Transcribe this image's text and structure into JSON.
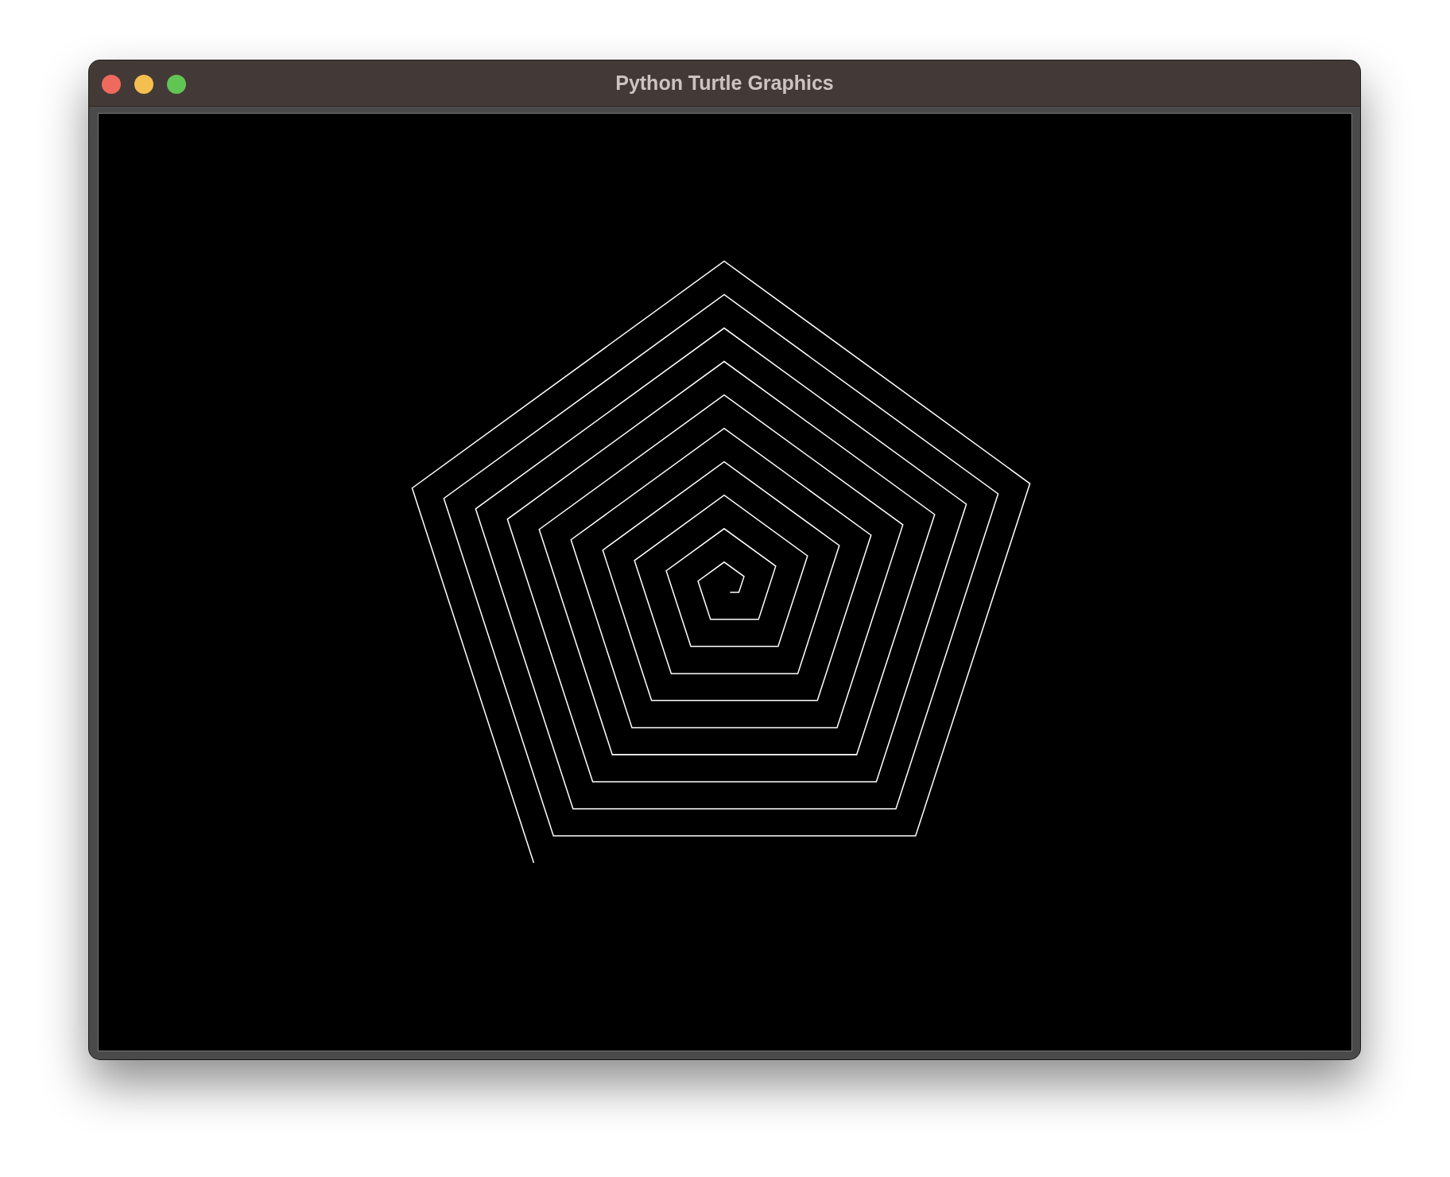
{
  "window": {
    "title": "Python Turtle Graphics"
  }
}
